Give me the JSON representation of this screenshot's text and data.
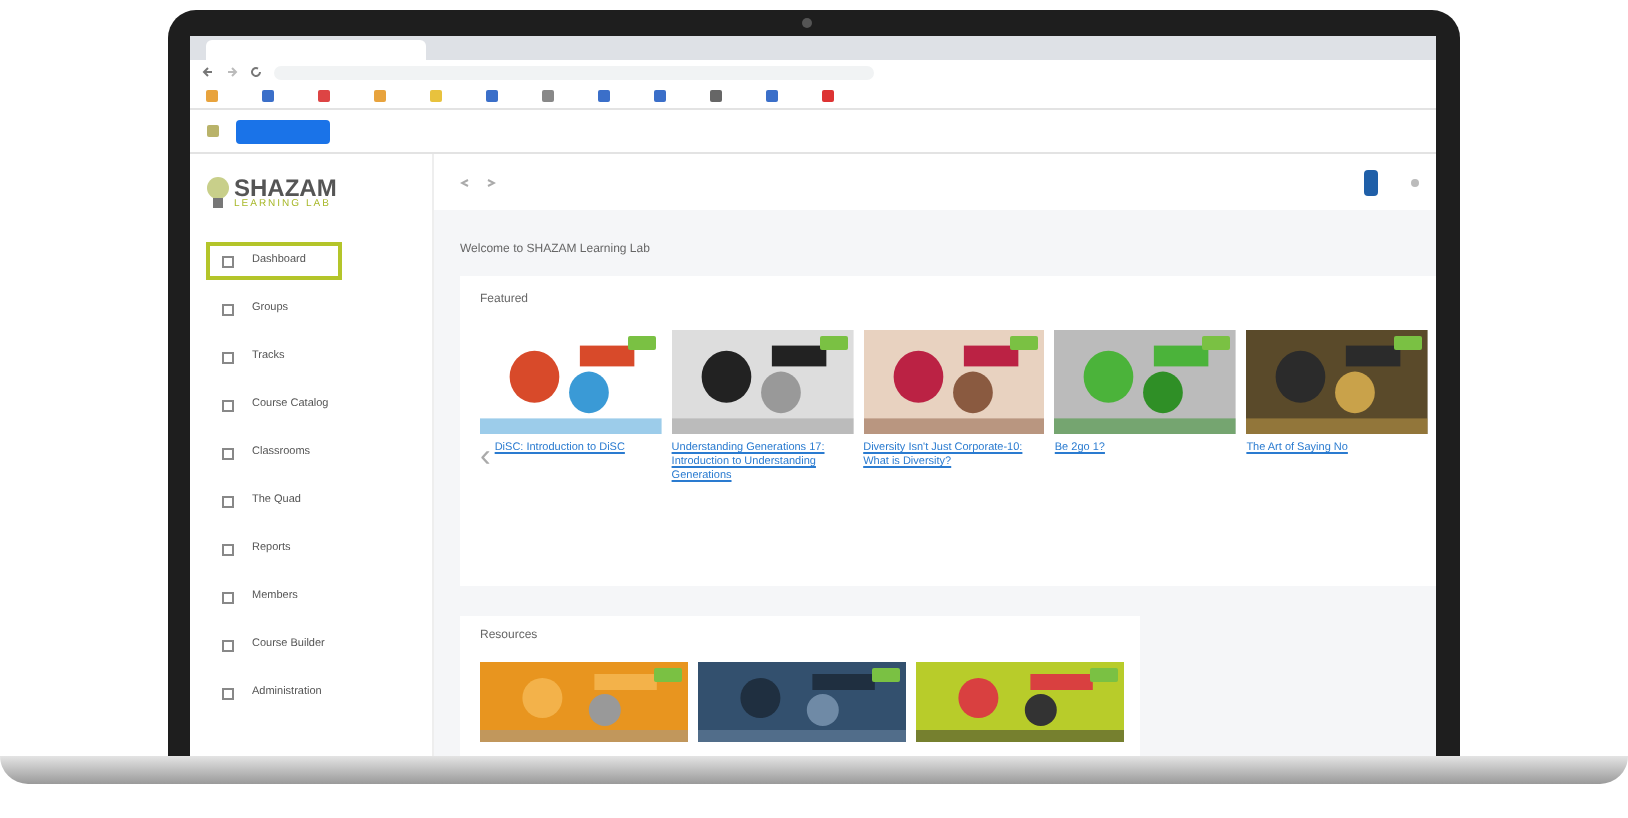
{
  "app": {
    "logo": {
      "name": "SHAZAM",
      "tagline": "LEARNING LAB"
    }
  },
  "sidebar": {
    "items": [
      {
        "label": "Dashboard",
        "selected": true
      },
      {
        "label": "Groups",
        "selected": false
      },
      {
        "label": "Tracks",
        "selected": false
      },
      {
        "label": "Course Catalog",
        "selected": false
      },
      {
        "label": "Classrooms",
        "selected": false
      },
      {
        "label": "The Quad",
        "selected": false
      },
      {
        "label": "Reports",
        "selected": false
      },
      {
        "label": "Members",
        "selected": false
      },
      {
        "label": "Course Builder",
        "selected": false
      },
      {
        "label": "Administration",
        "selected": false
      }
    ]
  },
  "welcome": "Welcome to SHAZAM Learning Lab",
  "featured": {
    "title": "Featured",
    "prev": "‹",
    "courses": [
      {
        "title": "DiSC: Introduction to DiSC"
      },
      {
        "title": "Understanding Generations 17: Introduction to Understanding Generations"
      },
      {
        "title": "Diversity Isn't Just Corporate-10: What is Diversity?"
      },
      {
        "title": "Be 2go 1?"
      },
      {
        "title": "The Art of Saying No"
      }
    ]
  },
  "resources": {
    "title": "Resources"
  }
}
